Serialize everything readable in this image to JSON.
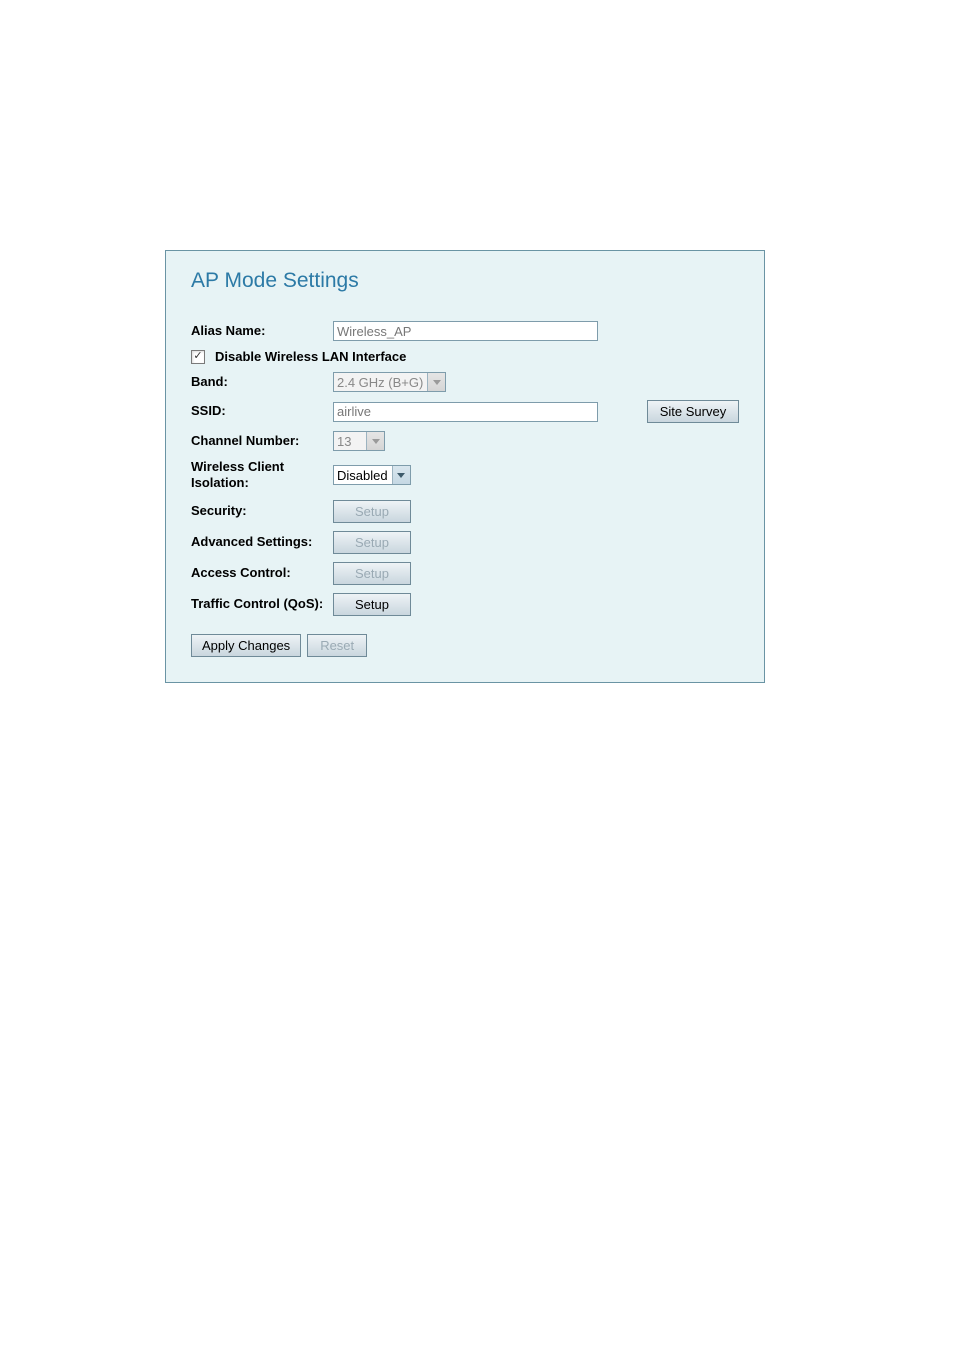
{
  "title": "AP Mode Settings",
  "rows": {
    "alias_label": "Alias Name:",
    "alias_value": "Wireless_AP",
    "disable_label": "Disable Wireless LAN Interface",
    "disable_checked": "✓",
    "band_label": "Band:",
    "band_value": "2.4 GHz (B+G)",
    "ssid_label": "SSID:",
    "ssid_value": "airlive",
    "site_survey": "Site Survey",
    "channel_label": "Channel Number:",
    "channel_value": "13",
    "isolation_label": "Wireless Client Isolation:",
    "isolation_value": "Disabled",
    "security_label": "Security:",
    "security_btn": "Setup",
    "advanced_label": "Advanced Settings:",
    "advanced_btn": "Setup",
    "access_label": "Access Control:",
    "access_btn": "Setup",
    "qos_label": "Traffic Control (QoS):",
    "qos_btn": "Setup"
  },
  "footer": {
    "apply": "Apply Changes",
    "reset": "Reset"
  }
}
